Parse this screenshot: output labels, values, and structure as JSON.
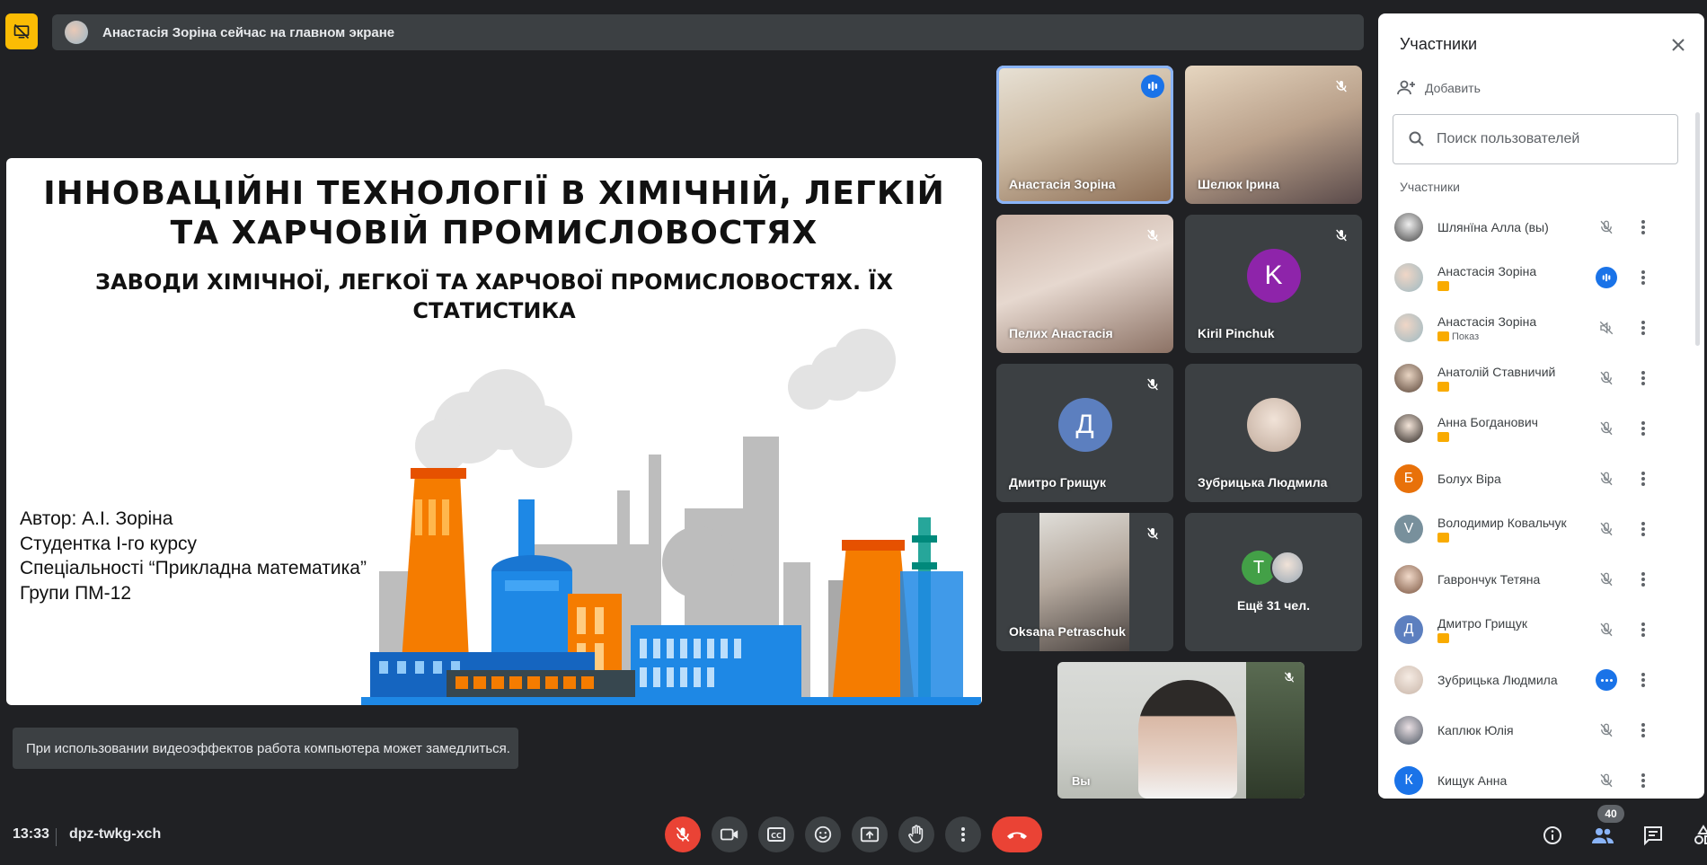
{
  "banner": {
    "text": "Анастасія Зоріна сейчас на главном экране"
  },
  "slide": {
    "title_line1": "ІННОВАЦІЙНІ ТЕХНОЛОГІЇ В ХІМІЧНІЙ, ЛЕГКІЙ",
    "title_line2": "ТА ХАРЧОВІЙ ПРОМИСЛОВОСТЯХ",
    "subtitle_line1": "ЗАВОДИ ХІМІЧНОЇ, ЛЕГКОЇ ТА ХАРЧОВОЇ ПРОМИСЛОВОСТЯХ. ЇХ",
    "subtitle_line2": "СТАТИСТИКА",
    "author": [
      "Автор: А.І. Зоріна",
      "Студентка І-го курсу",
      "Спеціальності “Прикладна математика”",
      "Групи ПМ-12"
    ]
  },
  "toast": "При использовании видеоэффектов работа компьютера может замедлиться.",
  "tiles": [
    {
      "name": "Анастасія Зоріна"
    },
    {
      "name": "Шелюк Ірина"
    },
    {
      "name": "Пелих Анастасія"
    },
    {
      "name": "Kiril Pinchuk",
      "initial": "K"
    },
    {
      "name": "Дмитро Грищук",
      "initial": "Д"
    },
    {
      "name": "Зубрицька Людмила"
    },
    {
      "name": "Oksana Petraschuk"
    },
    {
      "more_label": "Ещё 31 чел.",
      "initial": "Т"
    }
  ],
  "self_view": {
    "label": "Вы"
  },
  "panel": {
    "title": "Участники",
    "add_label": "Добавить",
    "search_placeholder": "Поиск пользователей",
    "section_label": "Участники",
    "people": [
      {
        "name": "Шлянїна Алла (вы)",
        "status": "muted"
      },
      {
        "name": "Анастасія Зоріна",
        "status": "speaking",
        "badge": true
      },
      {
        "name": "Анастасія Зоріна",
        "status": "muted-volume",
        "badge": true,
        "sub": "Показ"
      },
      {
        "name": "Анатолій Ставничий",
        "status": "muted",
        "badge": true
      },
      {
        "name": "Анна Богданович",
        "status": "muted",
        "badge": true
      },
      {
        "name": "Болух Віра",
        "status": "muted",
        "initial": "Б",
        "color": "#e8710a"
      },
      {
        "name": "Володимир Ковальчук",
        "status": "muted",
        "badge": true,
        "initial": "V",
        "color": "#78909c"
      },
      {
        "name": "Гаврончук Тетяна",
        "status": "muted"
      },
      {
        "name": "Дмитро Грищук",
        "status": "muted",
        "badge": true,
        "initial": "Д",
        "color": "#5c7fbf"
      },
      {
        "name": "Зубрицька Людмила",
        "status": "dots"
      },
      {
        "name": "Каплюк Юлія",
        "status": "muted"
      },
      {
        "name": "Кищук Анна",
        "status": "muted",
        "initial": "К",
        "color": "#1a73e8"
      }
    ]
  },
  "bottom": {
    "time": "13:33",
    "meeting_code": "dpz-twkg-xch",
    "participant_count": "40"
  },
  "colors": {
    "background": "#202124",
    "tile": "#3c4043",
    "accent_blue": "#1a73e8",
    "danger_red": "#ea4335",
    "presenter_yellow": "#fbbc04"
  }
}
